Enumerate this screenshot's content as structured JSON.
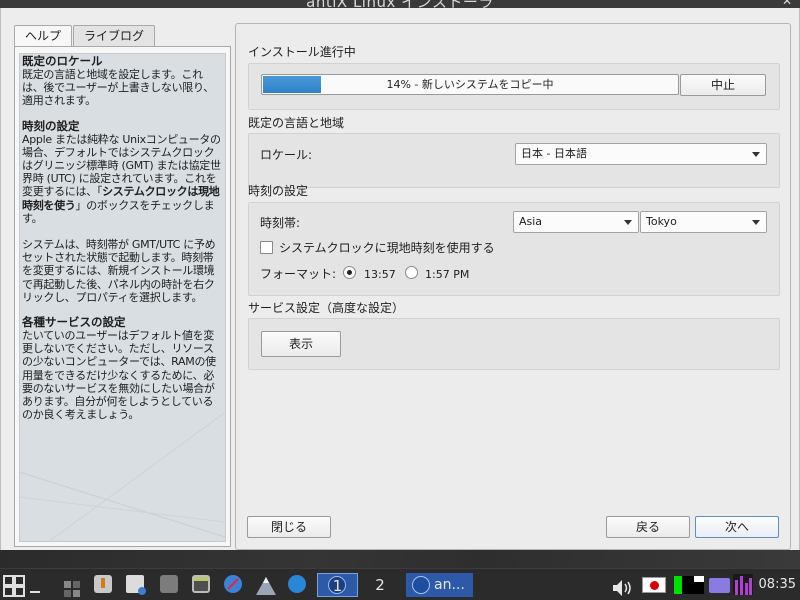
{
  "window": {
    "title": "antiX Linux インストーラ",
    "close_glyph": "✕"
  },
  "help": {
    "tabs": [
      {
        "label": "ヘルプ",
        "active": true
      },
      {
        "label": "ライブログ",
        "active": false
      }
    ],
    "sections": [
      {
        "heading": "既定のロケール",
        "body": "既定の言語と地域を設定します。これは、後でユーザーが上書きしない限り、適用されます。"
      },
      {
        "heading": "時刻の設定",
        "body_before": "Apple または純粋な Unixコンピュータの場合、デフォルトではシステムクロックはグリニッジ標準時 (GMT) または協定世界時 (UTC) に設定されています。これを変更するには、「",
        "body_bold": "システムクロックは現地時刻を使う",
        "body_after": "」のボックスをチェックします。",
        "body2": "システムは、時刻帯が GMT/UTC に予めセットされた状態で起動します。時刻帯を変更するには、新規インストール環境で再起動した後、パネル内の時計を右クリックし、プロパティを選択します。"
      },
      {
        "heading": "各種サービスの設定",
        "body": "たいていのユーザーはデフォルト値を変更しないでください。ただし、リソースの少ないコンピューターでは、RAMの使用量をできるだけ少なくするために、必要のないサービスを無効にしたい場合があります。自分が何をしようとしているのか良く考えましょう。"
      }
    ]
  },
  "install": {
    "group_title": "インストール進行中",
    "progress_text": "14% - 新しいシステムをコピー中",
    "progress_fraction": 0.14,
    "abort_label": "中止"
  },
  "locale": {
    "group_title": "既定の言語と地域",
    "label": "ロケール:",
    "value": "日本 - 日本語"
  },
  "clock": {
    "group_title": "時刻の設定",
    "timezone_label": "時刻帯:",
    "region": "Asia",
    "city": "Tokyo",
    "local_clock_label": "システムクロックに現地時刻を使用する",
    "local_clock_checked": false,
    "format_label": "フォーマット:",
    "format_24": "13:57",
    "format_12": "1:57 PM",
    "format_selected": "24"
  },
  "services": {
    "group_title": "サービス設定（高度な設定）",
    "show_label": "表示"
  },
  "footer": {
    "close_label": "閉じる",
    "back_label": "戻る",
    "next_label": "次へ"
  },
  "taskbar": {
    "workspace_1": "1",
    "workspace_2": "2",
    "task_label": "an...",
    "time": "08:35",
    "icons": [
      "app-menu-icon",
      "show-desktop-icon",
      "workspaces-icon",
      "installer-icon",
      "file-manager-icon",
      "drive-icon",
      "terminal-icon",
      "browser-icon",
      "mountain-icon",
      "network-icon",
      "volume-icon",
      "flag-icon",
      "cpu-monitor-icon",
      "mem-monitor-icon",
      "tray-icon",
      "net-monitor-icon"
    ],
    "colors": {
      "bar": "#2b2b2b",
      "active_task": "#2d5aa8",
      "flag_red": "#d90000",
      "monitor_green": "#00e000",
      "monitor_purple": "#8b5fd6"
    }
  }
}
